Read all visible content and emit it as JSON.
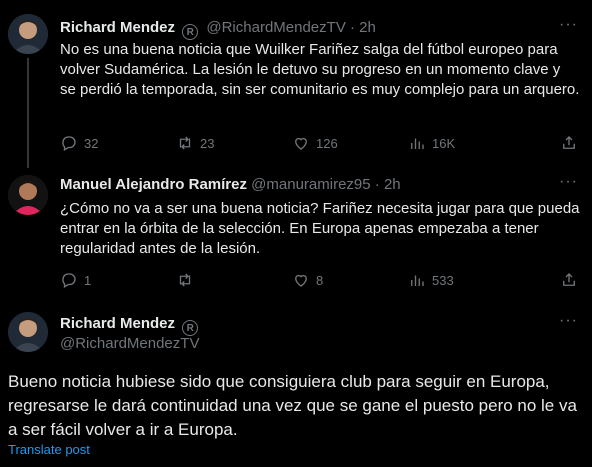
{
  "tweets": [
    {
      "name": "Richard Mendez",
      "handle": "@RichardMendezTV",
      "time": "· 2h",
      "text": "No es una buena noticia que Wuilker Fariñez salga del fútbol europeo para volver Sudamérica. La lesión le detuvo su progreso en un momento clave y se perdió la temporada,  sin ser comunitario es muy complejo para un arquero.",
      "replies": "32",
      "retweets": "23",
      "likes": "126",
      "views": "16K"
    },
    {
      "name": "Manuel Alejandro Ramírez",
      "handle": "@manuramirez95",
      "time": "· 2h",
      "text": "¿Cómo no va a ser una buena noticia? Fariñez necesita jugar para que pueda entrar en la órbita de la selección. En Europa apenas empezaba a tener regularidad antes de la lesión.",
      "replies": "1",
      "retweets": "",
      "likes": "8",
      "views": "533"
    }
  ],
  "main_tweet": {
    "name": "Richard Mendez",
    "handle": "@RichardMendezTV",
    "badge": "R",
    "text": "Bueno noticia hubiese sido que consiguiera club para seguir en Europa, regresarse le dará continuidad una vez que se gane el puesto pero no le va a ser fácil volver a ir a Europa.",
    "translate": "Translate post"
  },
  "more_label": "···",
  "icons": [
    "reply-icon",
    "retweet-icon",
    "like-icon",
    "views-icon",
    "share-icon",
    "more-icon",
    "verified-badge-icon"
  ]
}
